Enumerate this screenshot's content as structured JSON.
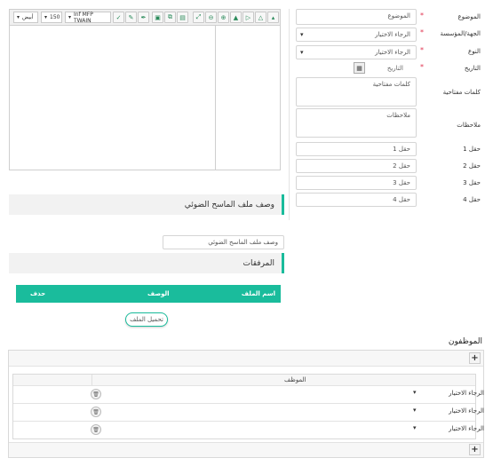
{
  "form": {
    "subject": {
      "label": "الموضوع",
      "placeholder": "الموضوع"
    },
    "entity": {
      "label": "الجهة/المؤسسة",
      "value": "الرجاء الاختيار"
    },
    "type": {
      "label": "النوع",
      "value": "الرجاء الاختيار"
    },
    "date": {
      "label": "التاريخ",
      "placeholder": "التاريخ"
    },
    "keywords": {
      "label": "كلمات مفتاحية",
      "placeholder": "كلمات مفتاحية"
    },
    "notes": {
      "label": "ملاحظات",
      "placeholder": "ملاحظات"
    },
    "fields": [
      {
        "label": "حقل 1",
        "placeholder": "حقل 1"
      },
      {
        "label": "حقل 2",
        "placeholder": "حقل 2"
      },
      {
        "label": "حقل 3",
        "placeholder": "حقل 3"
      },
      {
        "label": "حقل 4",
        "placeholder": "حقل 4"
      }
    ]
  },
  "scanner": {
    "source": "Inf MFP TWAIN",
    "dpi": "150",
    "color_mode": "أبيض",
    "icons": [
      "pin-icon",
      "pen-icon",
      "scan-icon",
      "copy-icon",
      "stack-icon",
      "fit-icon",
      "zoom-out-icon",
      "zoom-in-icon",
      "flip-icon",
      "rotate-icon",
      "mountain-icon",
      "mountain-alt-icon"
    ]
  },
  "scan_description": {
    "heading": "وصف ملف الماسح الضوئي",
    "placeholder": "وصف ملف الماسح الضوئي"
  },
  "attachments": {
    "heading": "المرفقات",
    "columns": [
      "اسم الملف",
      "الوصف",
      "حذف"
    ],
    "upload_label": "تحميل الملف"
  },
  "employees": {
    "heading": "الموظفون",
    "column": "الموظف",
    "rows": [
      {
        "value": "الرجاء الاختيار"
      },
      {
        "value": "الرجاء الاختيار"
      },
      {
        "value": "الرجاء الاختيار"
      }
    ]
  },
  "colors": {
    "accent": "#1abc9c",
    "required": "#e0334f"
  }
}
